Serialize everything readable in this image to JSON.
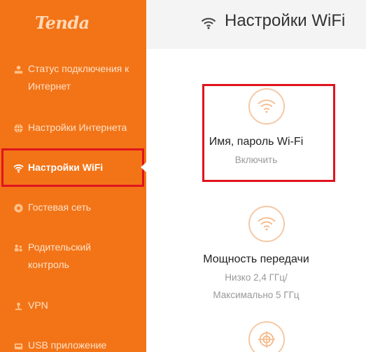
{
  "brand": {
    "logo_text": "Tenda",
    "accent": "#f27417",
    "highlight": "#e0141e"
  },
  "sidebar": {
    "items": [
      {
        "label_line1": "Статус подключения к",
        "label_line2": "Интернет",
        "icon": "globe-status-icon"
      },
      {
        "label": "Настройки Интернета",
        "icon": "globe-icon"
      },
      {
        "label": "Настройки WiFi",
        "icon": "wifi-icon",
        "active": true
      },
      {
        "label": "Гостевая сеть",
        "icon": "guest-network-icon"
      },
      {
        "label_line1": "Родительский",
        "label_line2": "контроль",
        "icon": "parental-control-icon"
      },
      {
        "label": "VPN",
        "icon": "vpn-icon"
      },
      {
        "label": "USB приложение",
        "icon": "usb-icon"
      }
    ]
  },
  "header": {
    "title": "Настройки WiFi",
    "icon": "wifi-icon"
  },
  "cards": [
    {
      "name": "Имя, пароль Wi-Fi",
      "sub_line1": "Включить",
      "icon": "wifi-icon"
    },
    {
      "name": "Мощность передачи",
      "sub_line1": "Низко 2,4 ГГц/",
      "sub_line2": "Максимально 5 ГГц",
      "icon": "wifi-power-icon"
    },
    {
      "icon": "target-icon"
    }
  ]
}
